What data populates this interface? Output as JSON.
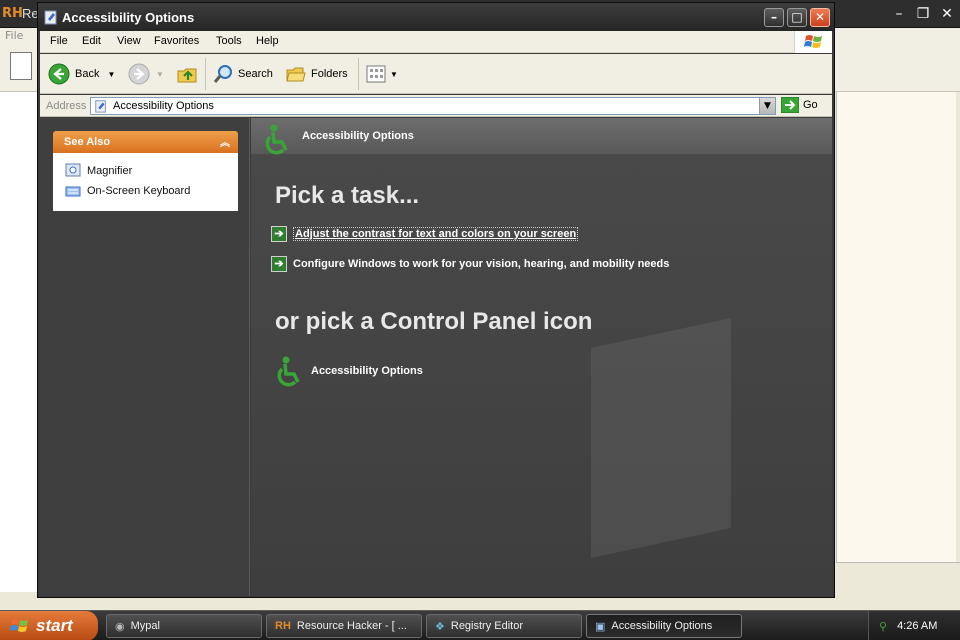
{
  "background_app": {
    "title": "Re",
    "logo_text": "RH",
    "menu_first": "File"
  },
  "window": {
    "title": "Accessibility Options",
    "controls": {
      "minimize": "–",
      "maximize": "□",
      "close": "✕"
    }
  },
  "menu": {
    "items": [
      {
        "label": "File"
      },
      {
        "label": "Edit"
      },
      {
        "label": "View"
      },
      {
        "label": "Favorites"
      },
      {
        "label": "Tools"
      },
      {
        "label": "Help"
      }
    ]
  },
  "toolbar": {
    "back_label": "Back",
    "search_label": "Search",
    "folders_label": "Folders"
  },
  "address": {
    "label": "Address",
    "value": "Accessibility Options",
    "go_label": "Go"
  },
  "see_also": {
    "title": "See Also",
    "items": [
      {
        "label": "Magnifier"
      },
      {
        "label": "On-Screen Keyboard"
      }
    ]
  },
  "content": {
    "header_title": "Accessibility Options",
    "pick_task_heading": "Pick a task...",
    "tasks": [
      {
        "label": "Adjust the contrast for text and colors on your screen"
      },
      {
        "label": "Configure Windows to work for your vision, hearing, and mobility needs"
      }
    ],
    "or_heading": "or pick a Control Panel icon",
    "cp_icon_label": "Accessibility Options"
  },
  "taskbar": {
    "start_label": "start",
    "buttons": [
      {
        "label": "Mypal"
      },
      {
        "label": "Resource Hacker - [ ..."
      },
      {
        "label": "Registry Editor"
      },
      {
        "label": "Accessibility Options"
      }
    ],
    "clock": "4:26 AM"
  },
  "colors": {
    "see_also_header": "#e8892f",
    "content_bg": "#454545",
    "title_bar": "#2d2d2d",
    "accessibility_icon_green": "#3aa537"
  }
}
